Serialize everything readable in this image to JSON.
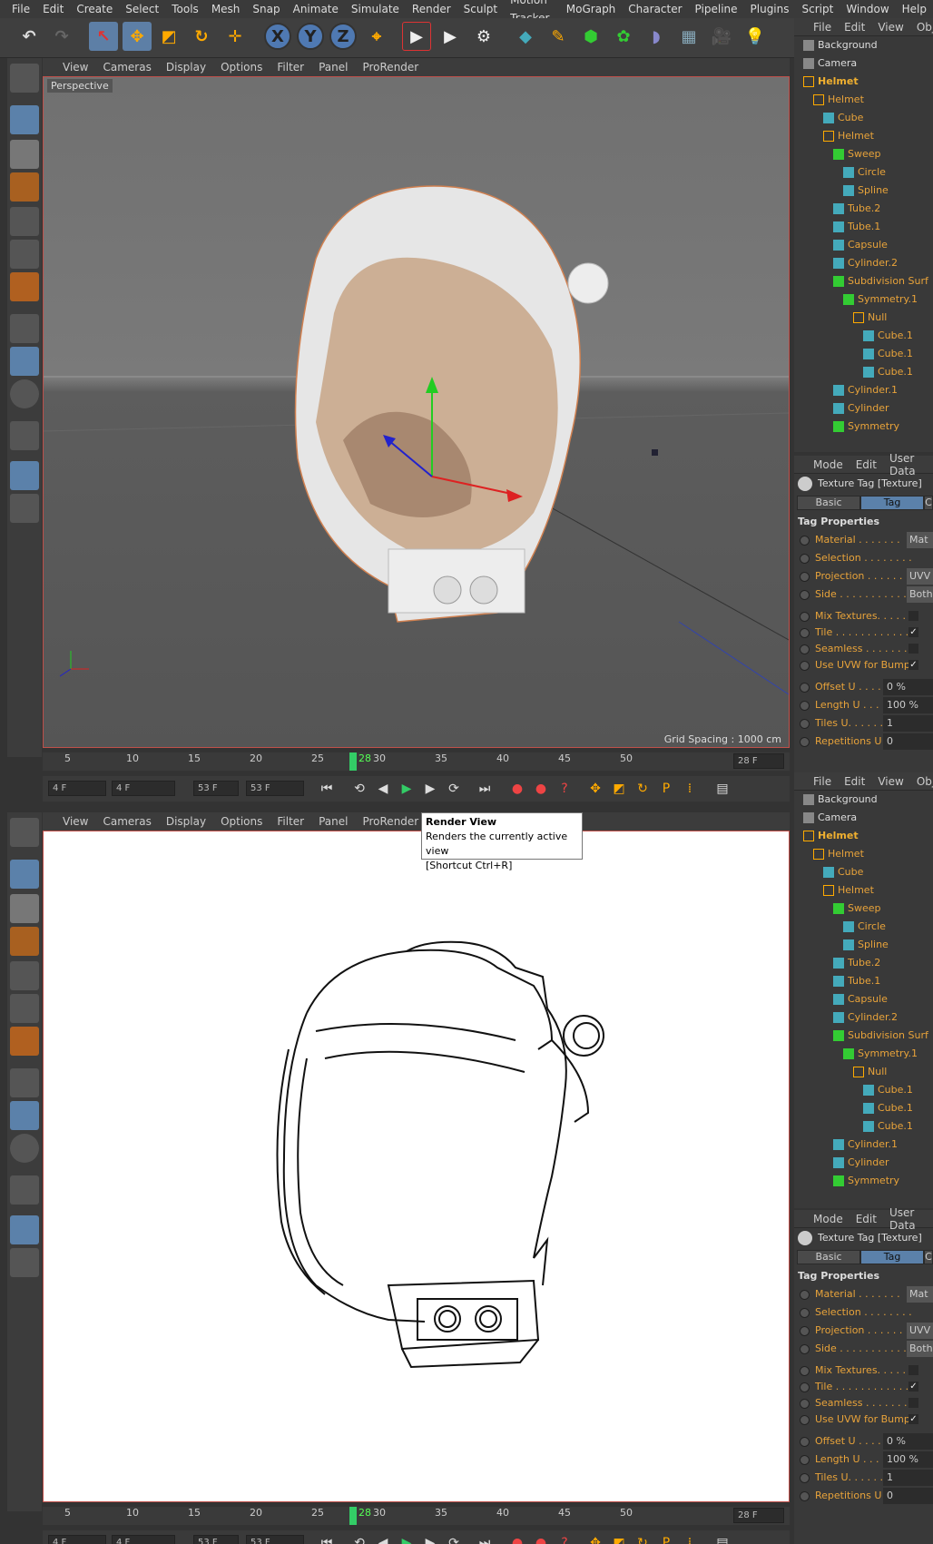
{
  "menu": [
    "File",
    "Edit",
    "Create",
    "Select",
    "Tools",
    "Mesh",
    "Snap",
    "Animate",
    "Simulate",
    "Render",
    "Sculpt",
    "Motion Tracker",
    "MoGraph",
    "Character",
    "Pipeline",
    "Plugins",
    "Script",
    "Window",
    "Help"
  ],
  "viewport_menu": [
    "View",
    "Cameras",
    "Display",
    "Options",
    "Filter",
    "Panel",
    "ProRender"
  ],
  "viewport1": {
    "label": "Perspective",
    "grid_spacing": "Grid Spacing : 1000 cm"
  },
  "object_manager": {
    "menu": [
      "File",
      "Edit",
      "View",
      "Obj"
    ],
    "items": [
      {
        "name": "Background",
        "indent": 0,
        "color": "#dddddd"
      },
      {
        "name": "Camera",
        "indent": 0,
        "color": "#dddddd"
      },
      {
        "name": "Helmet",
        "indent": 0,
        "color": "#f0b030"
      },
      {
        "name": "Helmet",
        "indent": 1,
        "color": "#e8a33a"
      },
      {
        "name": "Cube",
        "indent": 2,
        "color": "#e8a33a"
      },
      {
        "name": "Helmet",
        "indent": 2,
        "color": "#e8a33a"
      },
      {
        "name": "Sweep",
        "indent": 3,
        "color": "#e8a33a"
      },
      {
        "name": "Circle",
        "indent": 4,
        "color": "#e8a33a"
      },
      {
        "name": "Spline",
        "indent": 4,
        "color": "#e8a33a"
      },
      {
        "name": "Tube.2",
        "indent": 3,
        "color": "#e8a33a"
      },
      {
        "name": "Tube.1",
        "indent": 3,
        "color": "#e8a33a"
      },
      {
        "name": "Capsule",
        "indent": 3,
        "color": "#e8a33a"
      },
      {
        "name": "Cylinder.2",
        "indent": 3,
        "color": "#e8a33a"
      },
      {
        "name": "Subdivision Surf",
        "indent": 3,
        "color": "#e8a33a"
      },
      {
        "name": "Symmetry.1",
        "indent": 4,
        "color": "#e8a33a"
      },
      {
        "name": "Null",
        "indent": 5,
        "color": "#e8a33a"
      },
      {
        "name": "Cube.1",
        "indent": 6,
        "color": "#e8a33a"
      },
      {
        "name": "Cube.1",
        "indent": 6,
        "color": "#e8a33a"
      },
      {
        "name": "Cube.1",
        "indent": 6,
        "color": "#e8a33a"
      },
      {
        "name": "Cylinder.1",
        "indent": 3,
        "color": "#e8a33a"
      },
      {
        "name": "Cylinder",
        "indent": 3,
        "color": "#e8a33a"
      },
      {
        "name": "Symmetry",
        "indent": 3,
        "color": "#e8a33a"
      }
    ]
  },
  "attributes": {
    "menu": [
      "Mode",
      "Edit",
      "User Data"
    ],
    "title": "Texture Tag [Texture]",
    "tabs": [
      "Basic",
      "Tag",
      "C"
    ],
    "section": "Tag Properties",
    "rows": [
      {
        "label": "Material . . . . . . .",
        "value": "Mat"
      },
      {
        "label": "Selection . . . . . . . .",
        "value": ""
      },
      {
        "label": "Projection . . . . . . .",
        "value": "UVV"
      },
      {
        "label": "Side . . . . . . . . . . . .",
        "value": "Both"
      }
    ],
    "checks": [
      {
        "label": "Mix Textures. . . . . .",
        "checked": false
      },
      {
        "label": "Tile . . . . . . . . . . . .",
        "checked": true
      },
      {
        "label": "Seamless . . . . . . . .",
        "checked": false
      },
      {
        "label": "Use UVW for Bump",
        "checked": true
      }
    ],
    "offsets": [
      {
        "label": "Offset U . . . .",
        "value": "0 %"
      },
      {
        "label": "Length U . . . .",
        "value": "100 %"
      },
      {
        "label": "Tiles U. . . . . .",
        "value": "1"
      },
      {
        "label": "Repetitions U",
        "value": "0"
      }
    ]
  },
  "timeline": {
    "ticks": [
      "5",
      "10",
      "15",
      "20",
      "25",
      "28",
      "30",
      "35",
      "40",
      "45",
      "50"
    ],
    "current": "28 F"
  },
  "playback": {
    "start": "4 F",
    "range_start": "4 F",
    "range_end": "53 F",
    "end": "53 F"
  },
  "tooltip": {
    "title": "Render View",
    "desc": "Renders the currently active view",
    "shortcut": "[Shortcut Ctrl+R]"
  }
}
